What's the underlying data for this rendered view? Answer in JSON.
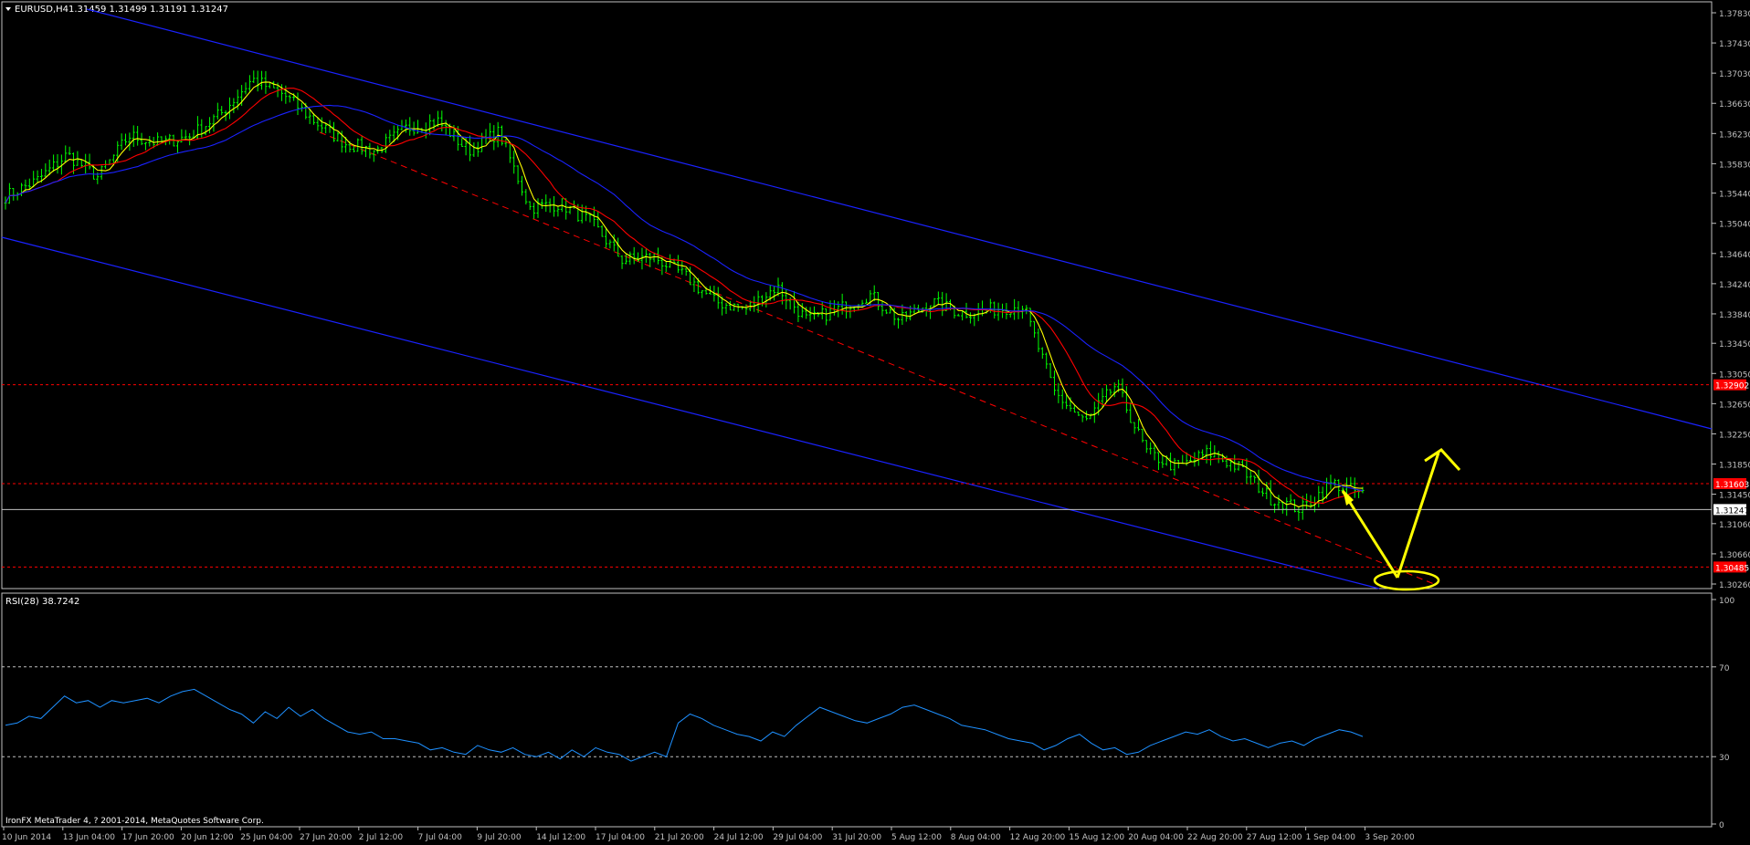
{
  "header": {
    "symbol_label": "EURUSD,H4",
    "ohlc": "1.31459 1.31499 1.31191 1.31247"
  },
  "footer": {
    "copyright": "IronFX MetaTrader 4, ? 2001-2014, MetaQuotes Software Corp."
  },
  "colors": {
    "background": "#000000",
    "axis": "#c0c0c0",
    "bar": "#00ff00",
    "ma_fast": "#ffff00",
    "ma_mid": "#ff0000",
    "ma_slow": "#1a22ff",
    "channel": "#1a22ff",
    "level_line": "#ff0000",
    "rsi_line": "#1e90ff",
    "annotation": "#ffff00",
    "price_tag_bg": "#ff0000"
  },
  "chart_data": [
    {
      "type": "candlestick",
      "symbol": "EURUSD",
      "timeframe": "H4",
      "ylim": [
        1.3026,
        1.3783
      ],
      "y_ticks": [
        1.3783,
        1.3743,
        1.3703,
        1.3663,
        1.3623,
        1.3583,
        1.3544,
        1.3504,
        1.3464,
        1.3424,
        1.3384,
        1.3345,
        1.3305,
        1.3265,
        1.3225,
        1.3185,
        1.3145,
        1.3106,
        1.3066,
        1.3026
      ],
      "y_tick_labels": [
        "1.37830",
        "1.37430",
        "1.37030",
        "1.36630",
        "1.36230",
        "1.35830",
        "1.35440",
        "1.35040",
        "1.34640",
        "1.34240",
        "1.33840",
        "1.33450",
        "1.33050",
        "1.32650",
        "1.32250",
        "1.31850",
        "1.31450",
        "1.31060",
        "1.30660",
        "1.30260"
      ],
      "x_tick_labels": [
        "10 Jun 2014",
        "13 Jun 04:00",
        "17 Jun 20:00",
        "20 Jun 12:00",
        "25 Jun 04:00",
        "27 Jun 20:00",
        "2 Jul 12:00",
        "7 Jul 04:00",
        "9 Jul 20:00",
        "14 Jul 12:00",
        "17 Jul 04:00",
        "21 Jul 20:00",
        "24 Jul 12:00",
        "29 Jul 04:00",
        "31 Jul 20:00",
        "5 Aug 12:00",
        "8 Aug 04:00",
        "12 Aug 20:00",
        "15 Aug 12:00",
        "20 Aug 04:00",
        "22 Aug 20:00",
        "27 Aug 12:00",
        "1 Sep 04:00",
        "3 Sep 20:00"
      ],
      "close_path": [
        1.354,
        1.356,
        1.3595,
        1.3565,
        1.362,
        1.361,
        1.362,
        1.365,
        1.3695,
        1.3675,
        1.364,
        1.361,
        1.36,
        1.363,
        1.364,
        1.36,
        1.3625,
        1.3525,
        1.353,
        1.3505,
        1.3455,
        1.346,
        1.3435,
        1.34,
        1.339,
        1.342,
        1.3375,
        1.339,
        1.341,
        1.3375,
        1.34,
        1.3385,
        1.339,
        1.3395,
        1.328,
        1.324,
        1.329,
        1.32,
        1.318,
        1.32,
        1.318,
        1.314,
        1.3125,
        1.316,
        1.3145
      ],
      "current_price": 1.31247,
      "current_price_label": "1.31247",
      "horizontal_levels": [
        {
          "value": 1.329,
          "label": "1.32902"
        },
        {
          "value": 1.3159,
          "label": "1.31603"
        },
        {
          "value": 1.30485,
          "label": "1.30485"
        }
      ]
    },
    {
      "type": "line",
      "name": "RSI(28)",
      "title": "RSI(28) 38.7242",
      "ylim": [
        0,
        100
      ],
      "y_ticks": [
        100,
        70,
        30,
        0
      ],
      "y_tick_labels": [
        "100",
        "70",
        "30",
        "0"
      ],
      "levels": [
        70,
        30
      ],
      "values": [
        44,
        45,
        48,
        47,
        52,
        57,
        54,
        55,
        52,
        55,
        54,
        55,
        56,
        54,
        57,
        59,
        60,
        57,
        54,
        51,
        49,
        45,
        50,
        47,
        52,
        48,
        51,
        47,
        44,
        41,
        40,
        41,
        38,
        38,
        37,
        36,
        33,
        34,
        32,
        31,
        35,
        33,
        32,
        34,
        31,
        30,
        32,
        29,
        33,
        30,
        34,
        32,
        31,
        28,
        30,
        32,
        30,
        45,
        49,
        47,
        44,
        42,
        40,
        39,
        37,
        41,
        39,
        44,
        48,
        52,
        50,
        48,
        46,
        45,
        47,
        49,
        52,
        53,
        51,
        49,
        47,
        44,
        43,
        42,
        40,
        38,
        37,
        36,
        33,
        35,
        38,
        40,
        36,
        33,
        34,
        31,
        32,
        35,
        37,
        39,
        41,
        40,
        42,
        39,
        37,
        38,
        36,
        34,
        36,
        37,
        35,
        38,
        40,
        42,
        41,
        39
      ]
    }
  ]
}
